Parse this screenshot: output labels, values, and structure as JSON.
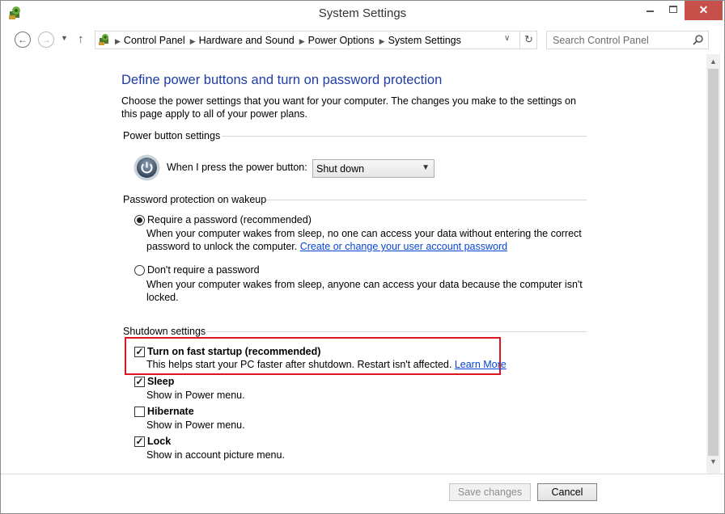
{
  "window": {
    "title": "System Settings",
    "close_glyph": "✕"
  },
  "nav": {
    "back_glyph": "←",
    "forward_glyph": "→",
    "recent_glyph": "▼",
    "up_glyph": "↑",
    "breadcrumbs": [
      "Control Panel",
      "Hardware and Sound",
      "Power Options",
      "System Settings"
    ],
    "refresh_glyph": "↻",
    "search_placeholder": "Search Control Panel"
  },
  "page": {
    "heading": "Define power buttons and turn on password protection",
    "intro": "Choose the power settings that you want for your computer. The changes you make to the settings on this page apply to all of your power plans."
  },
  "power_buttons": {
    "group_label": "Power button settings",
    "label": "When I press the power button:",
    "selected_value": "Shut down"
  },
  "password": {
    "group_label": "Password protection on wakeup",
    "require_label": "Require a password (recommended)",
    "require_desc": "When your computer wakes from sleep, no one can access your data without entering the correct password to unlock the computer.",
    "require_link": "Create or change your user account password",
    "require_selected": true,
    "no_require_label": "Don't require a password",
    "no_require_desc": "When your computer wakes from sleep, anyone can access your data because the computer isn't locked."
  },
  "shutdown": {
    "group_label": "Shutdown settings",
    "items": [
      {
        "label": "Turn on fast startup (recommended)",
        "desc": "This helps start your PC faster after shutdown. Restart isn't affected.",
        "link": "Learn More",
        "checked": true
      },
      {
        "label": "Sleep",
        "desc": "Show in Power menu.",
        "checked": true
      },
      {
        "label": "Hibernate",
        "desc": "Show in Power menu.",
        "checked": false
      },
      {
        "label": "Lock",
        "desc": "Show in account picture menu.",
        "checked": true
      }
    ]
  },
  "footer": {
    "save_label": "Save changes",
    "cancel_label": "Cancel"
  },
  "colors": {
    "heading": "#1e3da5",
    "link": "#0645d6",
    "highlight_border": "#e0141e",
    "close_button": "#c7504a"
  },
  "icons": {
    "app": "control-panel-icon",
    "power": "power-button-icon",
    "search": "search-icon"
  }
}
